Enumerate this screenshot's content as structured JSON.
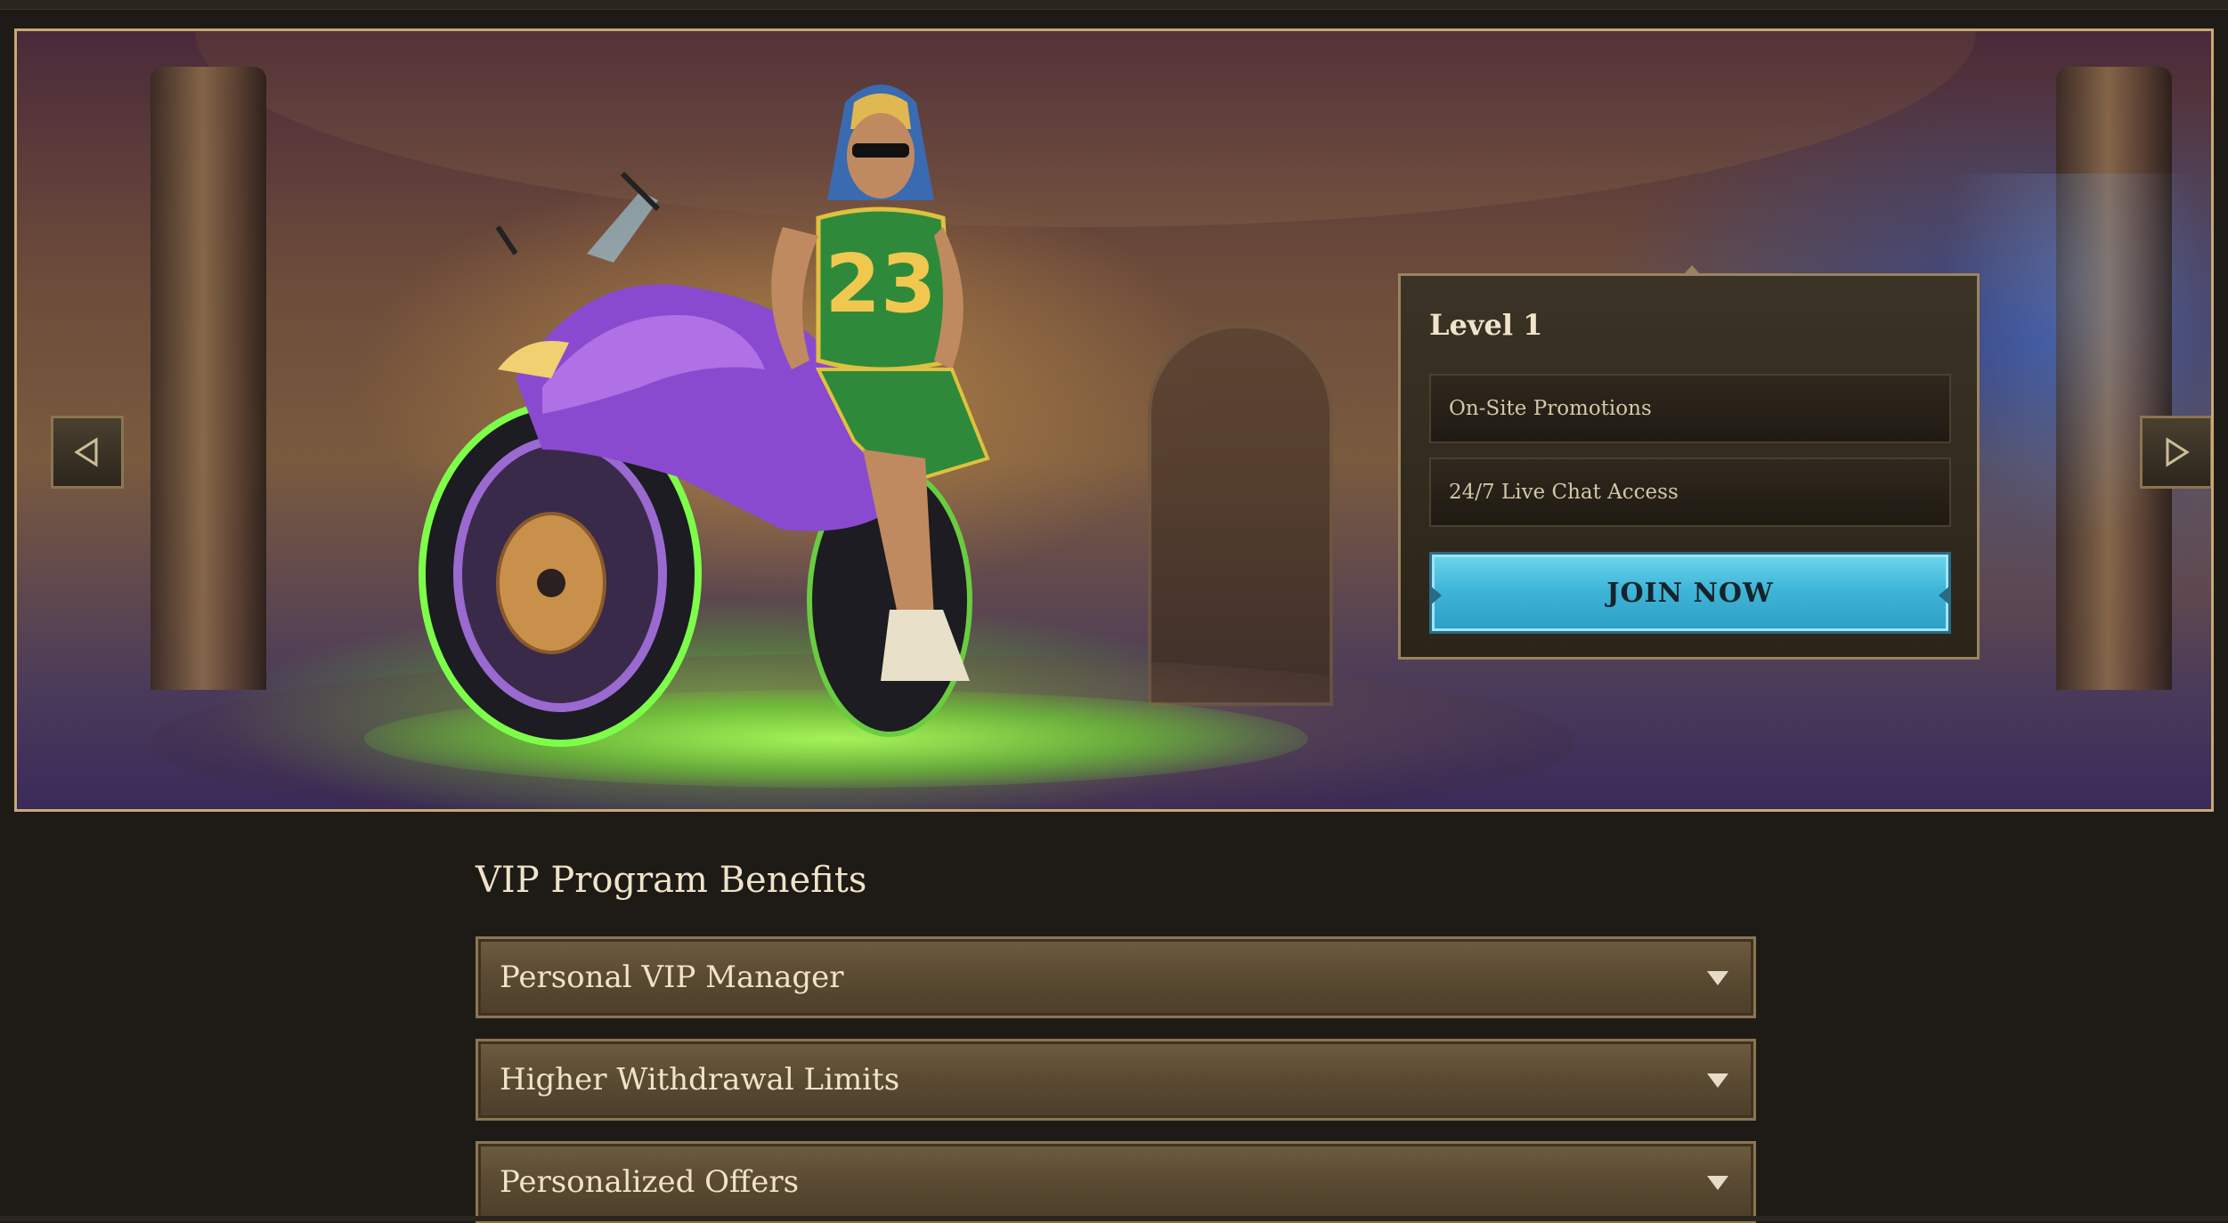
{
  "hero": {
    "level_card": {
      "title": "Level 1",
      "benefits": [
        "On-Site Promotions",
        "24/7 Live Chat Access"
      ],
      "cta_label": "JOIN NOW"
    },
    "jersey_number": "23"
  },
  "benefits_section": {
    "title": "VIP Program Benefits",
    "items": [
      {
        "label": "Personal VIP Manager"
      },
      {
        "label": "Higher Withdrawal Limits"
      },
      {
        "label": "Personalized Offers"
      }
    ]
  },
  "icons": {
    "prev": "chevron-left-icon",
    "next": "chevron-right-icon",
    "expand": "chevron-down-icon"
  },
  "colors": {
    "background": "#1e1b16",
    "frame_gold": "#c9a874",
    "cta": "#3fb6d8",
    "accordion": "#5a4a32",
    "text": "#efe3c9"
  }
}
